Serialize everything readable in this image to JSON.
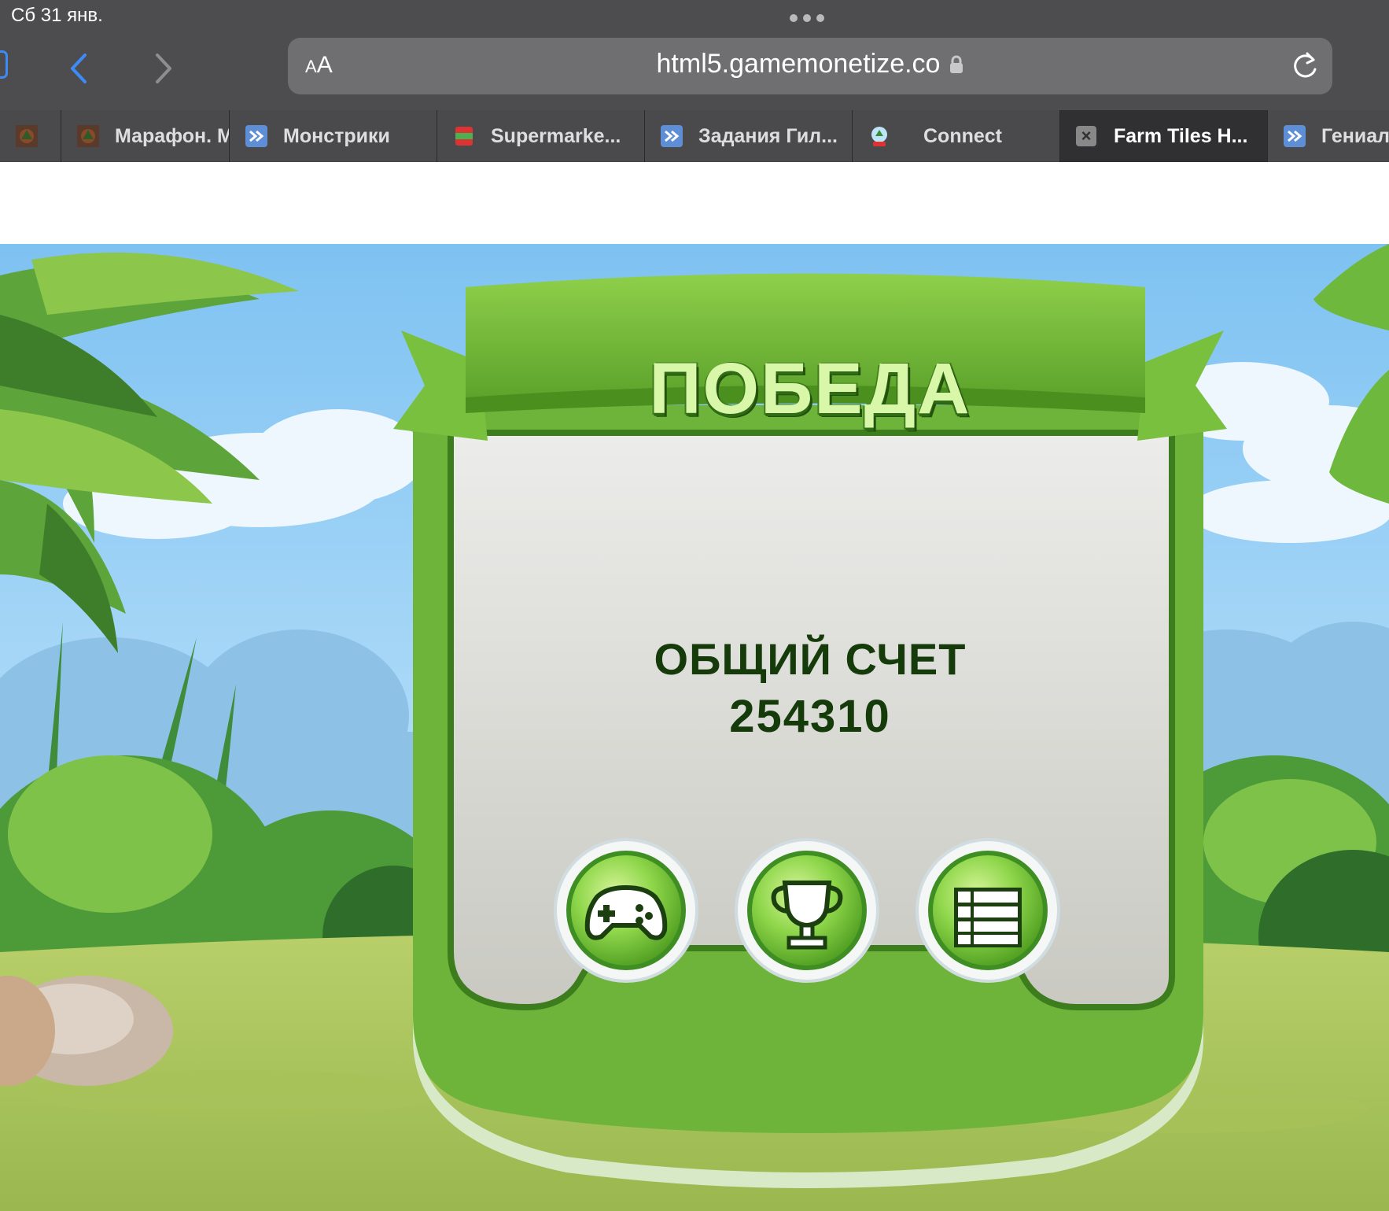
{
  "status": {
    "date": "Сб 31 янв."
  },
  "address_bar": {
    "aa_label": "AA",
    "url": "html5.gamemonetize.co"
  },
  "tabs": [
    {
      "label": "",
      "icon": "game-thumbnail-icon"
    },
    {
      "label": "Марафон. М",
      "icon": "game-thumbnail-icon"
    },
    {
      "label": "Монстрики",
      "icon": "arrows-favicon-icon"
    },
    {
      "label": "Supermarke...",
      "icon": "peas-can-favicon-icon"
    },
    {
      "label": "Задания Гил...",
      "icon": "arrows-favicon-icon"
    },
    {
      "label": "Connect",
      "icon": "snow-globe-favicon-icon"
    },
    {
      "label": "Farm Tiles H...",
      "icon": "close-icon",
      "active": true
    },
    {
      "label": "Гениал",
      "icon": "arrows-favicon-icon"
    }
  ],
  "game": {
    "title": "ПОБЕДА",
    "score_label": "ОБЩИЙ СЧЕТ",
    "score_value": "254310",
    "buttons": [
      {
        "name": "play",
        "icon": "gamepad-icon"
      },
      {
        "name": "leaderboard",
        "icon": "trophy-icon"
      },
      {
        "name": "menu",
        "icon": "list-icon"
      }
    ]
  }
}
